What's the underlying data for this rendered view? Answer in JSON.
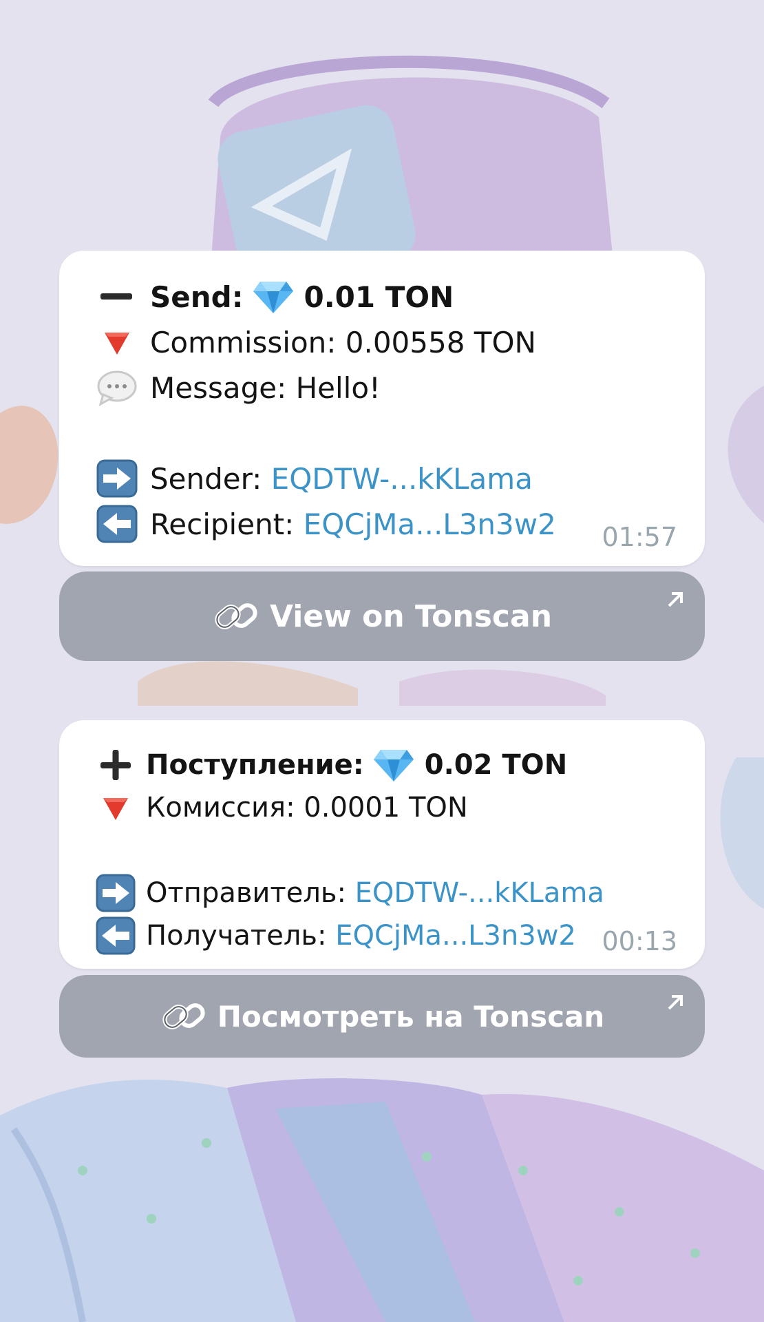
{
  "messages": [
    {
      "title_label": "Send:",
      "title_amount": "0.01 TON",
      "commission": "Commission: 0.00558 TON",
      "message": "Message: Hello!",
      "sender_label": "Sender: ",
      "sender_addr": "EQDTW-...kKLama",
      "recipient_label": "Recipient: ",
      "recipient_addr": "EQCjMa...L3n3w2",
      "time": "01:57",
      "button": "View on Tonscan"
    },
    {
      "title_label": "Поступление:",
      "title_amount": "0.02 TON",
      "commission": "Комиссия: 0.0001 TON",
      "sender_label": "Отправитель: ",
      "sender_addr": "EQDTW-...kKLama",
      "recipient_label": "Получатель: ",
      "recipient_addr": "EQCjMa...L3n3w2",
      "time": "00:13",
      "button": "Посмотреть на Tonscan"
    }
  ],
  "icons": {
    "send": "minus-icon",
    "receive": "plus-icon",
    "gem": "gem-icon",
    "commission": "red-triangle-down-icon",
    "message": "speech-bubble-icon",
    "sender": "right-arrow-icon",
    "recipient": "left-arrow-icon",
    "link": "chain-link-icon",
    "open": "arrow-up-right-icon"
  },
  "colors": {
    "link": "#3b93c7",
    "button_bg": "#8a9096",
    "wallpaper": "#e3e2ee"
  }
}
